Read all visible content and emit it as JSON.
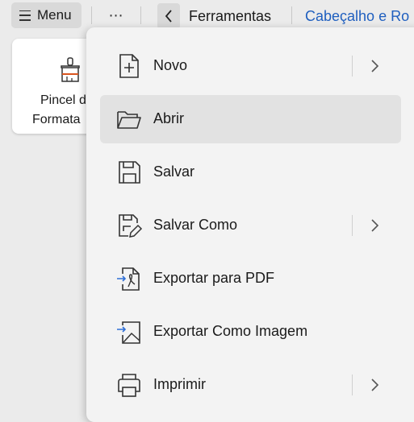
{
  "toolbar": {
    "menu_label": "Menu",
    "more_label": "⋯",
    "tab_tools": "Ferramentas",
    "tab_header": "Cabeçalho  e Ro"
  },
  "ribbon": {
    "format_painter_line1": "Pincel d",
    "format_painter_line2": "Formata"
  },
  "menu": {
    "items": [
      {
        "label": "Novo",
        "icon": "new-file-icon",
        "submenu": true
      },
      {
        "label": "Abrir",
        "icon": "folder-open-icon",
        "submenu": false,
        "highlighted": true
      },
      {
        "label": "Salvar",
        "icon": "save-icon",
        "submenu": false
      },
      {
        "label": "Salvar Como",
        "icon": "save-as-icon",
        "submenu": true
      },
      {
        "label": "Exportar para PDF",
        "icon": "export-pdf-icon",
        "submenu": false
      },
      {
        "label": "Exportar Como Imagem",
        "icon": "export-image-icon",
        "submenu": false
      },
      {
        "label": "Imprimir",
        "icon": "printer-icon",
        "submenu": true
      }
    ]
  },
  "colors": {
    "accent_link": "#1f5fbf",
    "export_arrow": "#2f6fd6",
    "brush_accent": "#d9541e"
  }
}
